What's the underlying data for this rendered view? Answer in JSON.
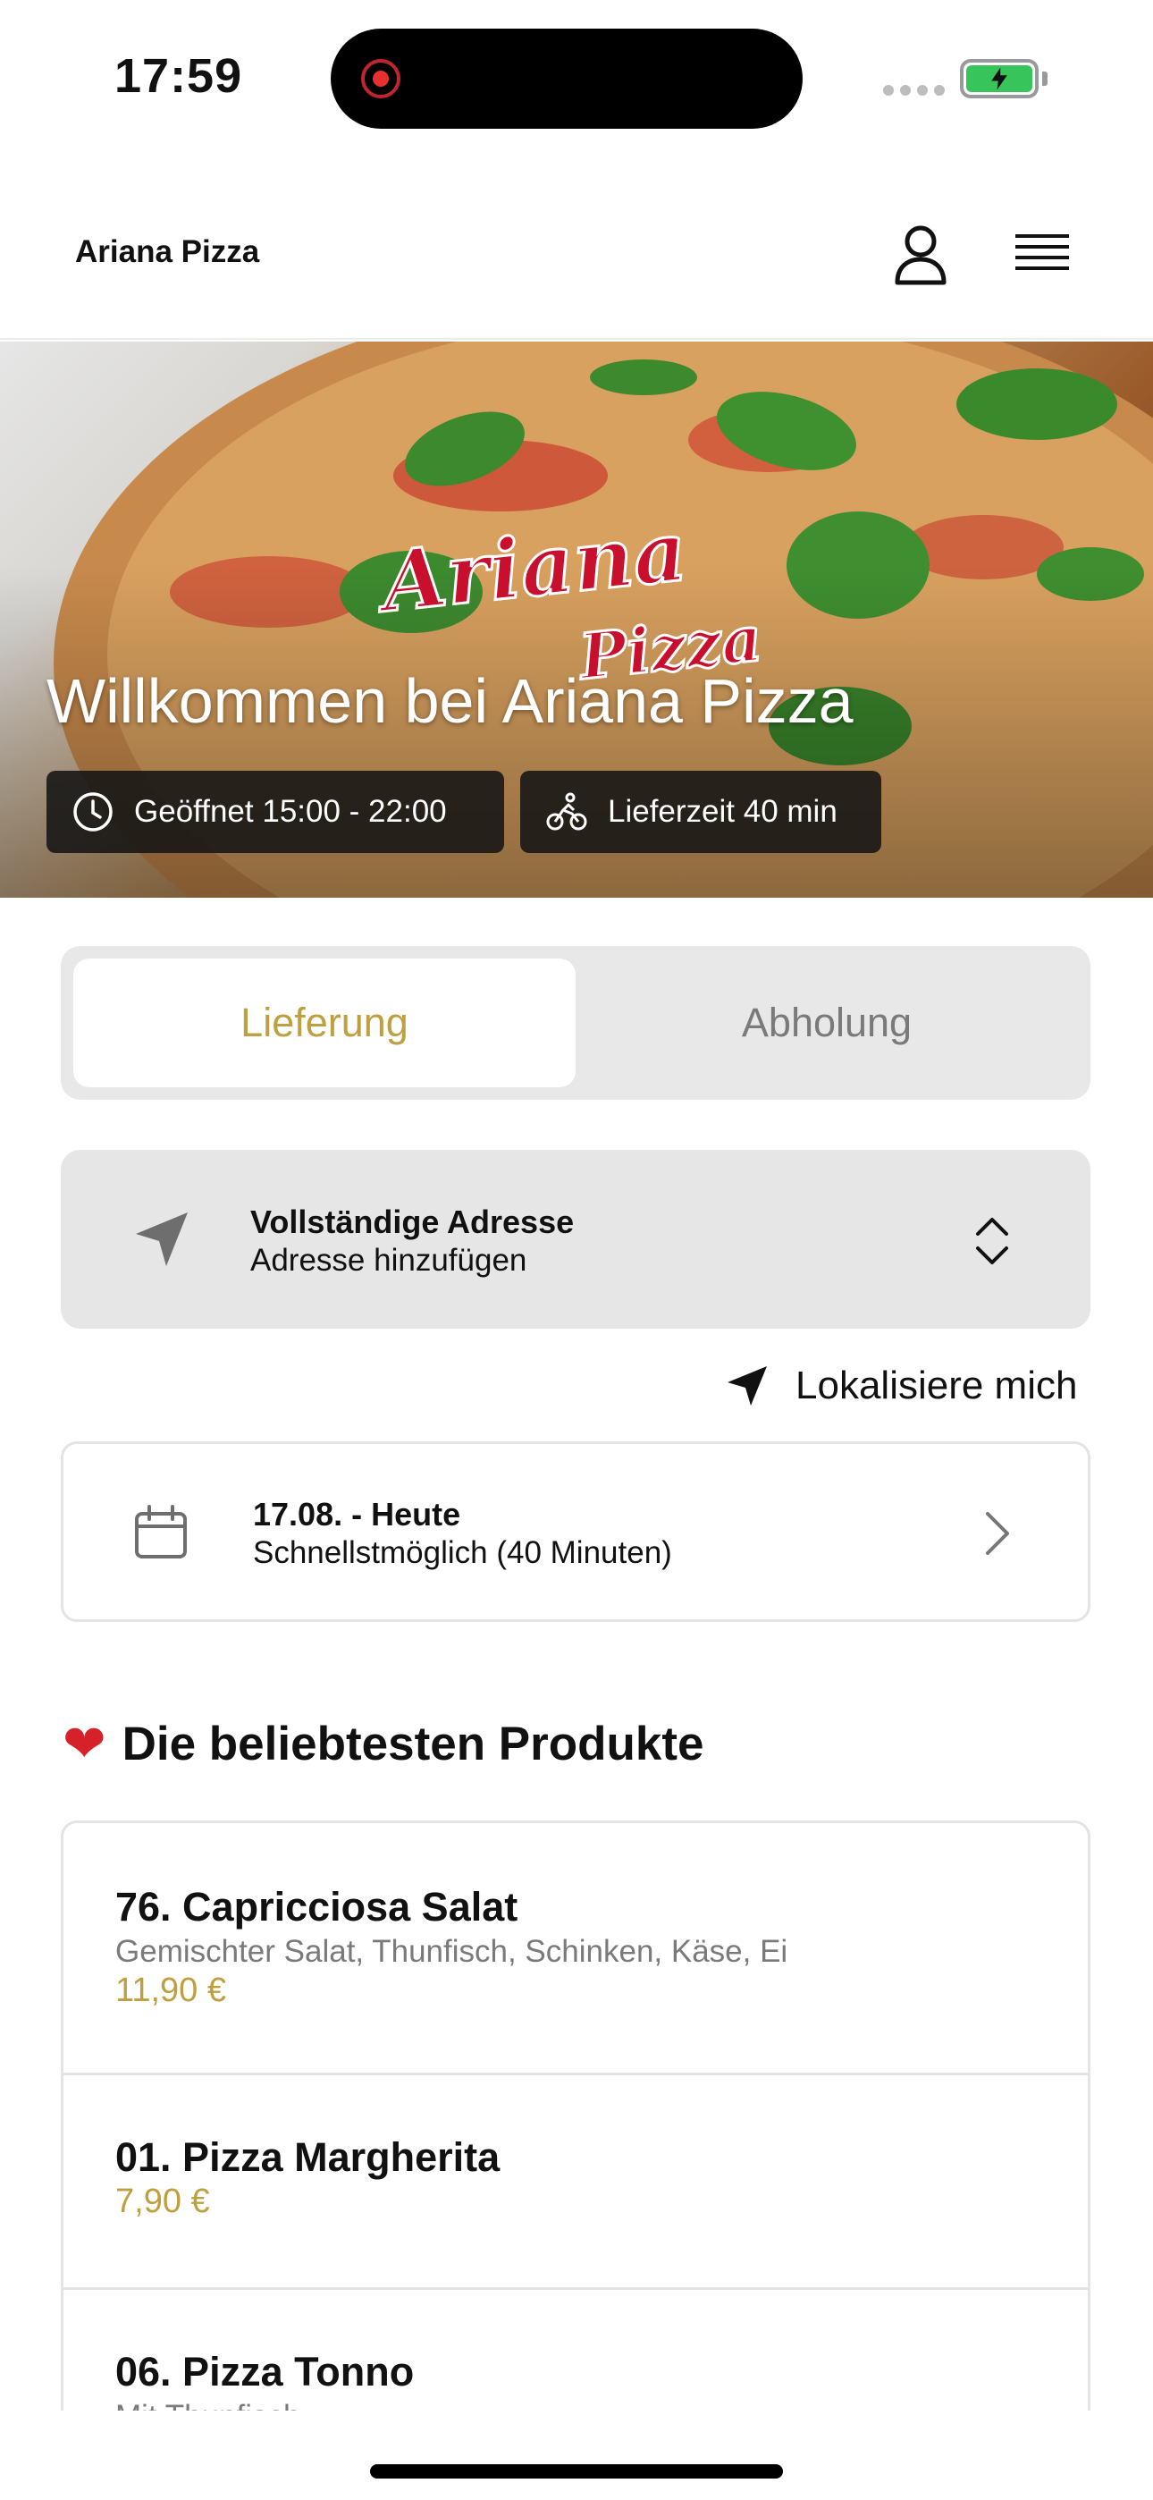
{
  "status_bar": {
    "time": "17:59"
  },
  "header": {
    "brand": "Ariana Pizza"
  },
  "hero": {
    "logo_text": "Ariana Pizza",
    "title": "Willkommen bei Ariana Pizza",
    "open_hours": "Geöffnet 15:00 - 22:00",
    "delivery_time": "Lieferzeit 40 min"
  },
  "mode_switch": {
    "delivery": "Lieferung",
    "pickup": "Abholung",
    "selected": "Lieferung"
  },
  "address": {
    "title": "Vollständige Adresse",
    "subtitle": "Adresse hinzufügen"
  },
  "locate": {
    "label": "Lokalisiere mich"
  },
  "date": {
    "title": "17.08. - Heute",
    "subtitle": "Schnellstmöglich (40 Minuten)"
  },
  "popular": {
    "title": "Die beliebtesten Produkte",
    "products": [
      {
        "name": "76. Capricciosa Salat",
        "description": "Gemischter Salat, Thunfisch, Schinken, Käse, Ei",
        "price": "11,90 €"
      },
      {
        "name": "01. Pizza Margherita",
        "description": "",
        "price": "7,90 €"
      },
      {
        "name": "06. Pizza Tonno",
        "description": "Mit Thunfisch",
        "price": ""
      }
    ]
  },
  "colors": {
    "accent": "#bfa040",
    "logo": "#c8102e"
  },
  "icons": [
    "battery-icon",
    "user-icon",
    "menu-icon",
    "clock-icon",
    "bicycle-icon",
    "navigation-arrow-icon",
    "chevron-up-down-icon",
    "calendar-icon",
    "chevron-right-icon",
    "heart-icon"
  ]
}
